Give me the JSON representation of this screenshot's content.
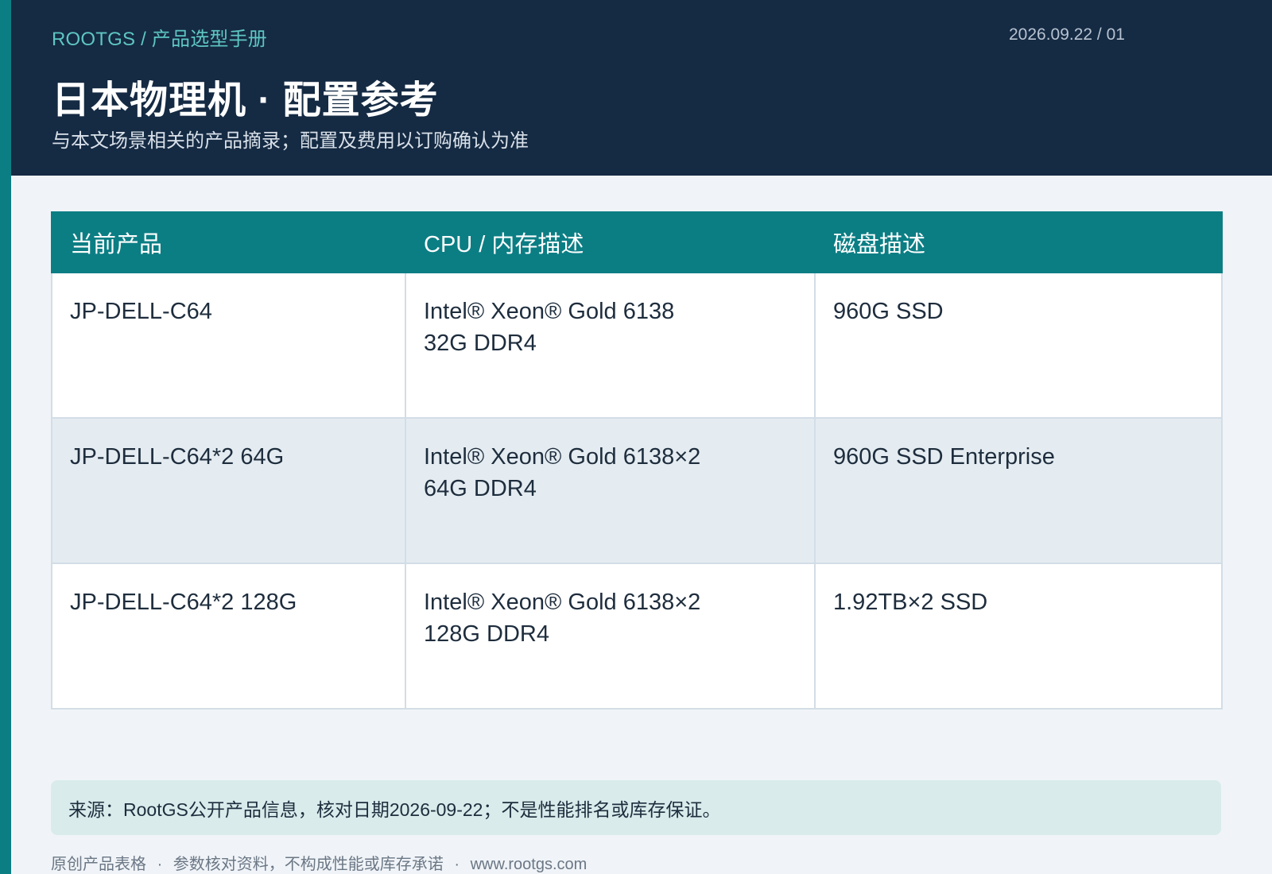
{
  "header": {
    "breadcrumb": "ROOTGS / 产品选型手册",
    "doc_stamp": "2026.09.22 / 01",
    "title": "日本物理机 · 配置参考",
    "subtitle": "与本文场景相关的产品摘录；配置及费用以订购确认为准"
  },
  "table": {
    "columns": [
      "当前产品",
      "CPU / 内存描述",
      "磁盘描述"
    ],
    "rows": [
      {
        "product": "JP-DELL-C64",
        "cpu": "Intel® Xeon® Gold 6138",
        "memory": "32G DDR4",
        "disk": "960G SSD"
      },
      {
        "product": "JP-DELL-C64*2 64G",
        "cpu": "Intel® Xeon® Gold 6138×2",
        "memory": "64G DDR4",
        "disk": "960G SSD Enterprise"
      },
      {
        "product": "JP-DELL-C64*2 128G",
        "cpu": "Intel® Xeon® Gold 6138×2",
        "memory": "128G DDR4",
        "disk": "1.92TB×2 SSD"
      }
    ]
  },
  "source_note": "来源：RootGS公开产品信息，核对日期2026-09-22；不是性能排名或库存保证。",
  "footer": {
    "items": [
      "原创产品表格",
      "参数核对资料，不构成性能或库存承诺",
      "www.rootgs.com"
    ],
    "separator": "·"
  },
  "colors": {
    "header_bg": "#152a43",
    "accent": "#0b7e84",
    "breadcrumb": "#5ec6c3",
    "page_bg": "#f0f4f8",
    "row_alt_bg": "#e4ecf1",
    "note_bg": "#d9ebeb"
  }
}
